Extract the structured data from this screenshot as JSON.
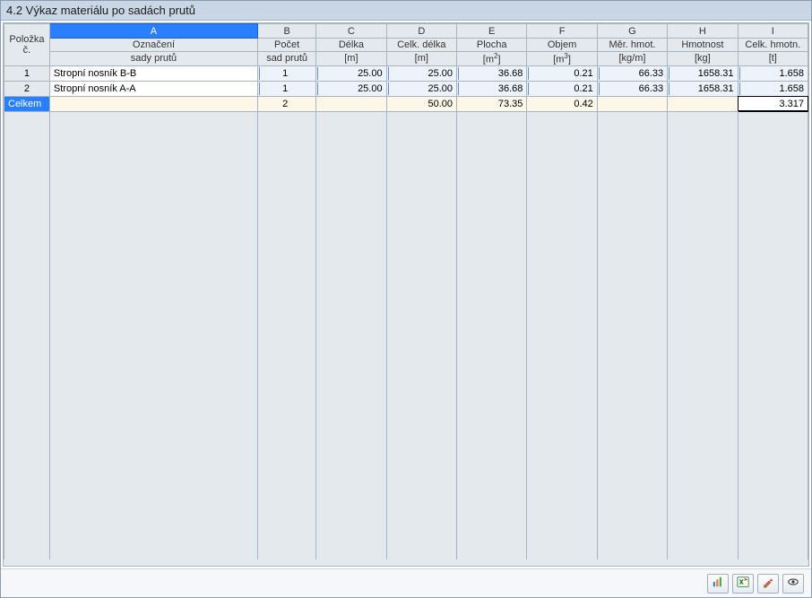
{
  "title": "4.2 Výkaz materiálu po sadách prutů",
  "columns": {
    "row_header1": "Položka",
    "row_header2": "č.",
    "letters": [
      "A",
      "B",
      "C",
      "D",
      "E",
      "F",
      "G",
      "H",
      "I"
    ],
    "h1": [
      "Označení",
      "Počet",
      "Délka",
      "Celk. délka",
      "Plocha",
      "Objem",
      "Měr. hmot.",
      "Hmotnost",
      "Celk. hmotn."
    ],
    "h2_A": "sady prutů",
    "h2_B": "sad prutů",
    "h2_C": "[m]",
    "h2_D": "[m]",
    "h2_G": "[kg/m]",
    "h2_H": "[kg]",
    "h2_I": "[t]"
  },
  "rows": [
    {
      "n": "1",
      "label": "Stropní nosník B-B",
      "B": "1",
      "C": "25.00",
      "D": "25.00",
      "E": "36.68",
      "F": "0.21",
      "G": "66.33",
      "H": "1658.31",
      "I": "1.658"
    },
    {
      "n": "2",
      "label": "Stropní nosník A-A",
      "B": "1",
      "C": "25.00",
      "D": "25.00",
      "E": "36.68",
      "F": "0.21",
      "G": "66.33",
      "H": "1658.31",
      "I": "1.658"
    }
  ],
  "total": {
    "label": "Celkem",
    "B": "2",
    "C": "",
    "D": "50.00",
    "E": "73.35",
    "F": "0.42",
    "G": "",
    "H": "",
    "I": "3.317"
  }
}
